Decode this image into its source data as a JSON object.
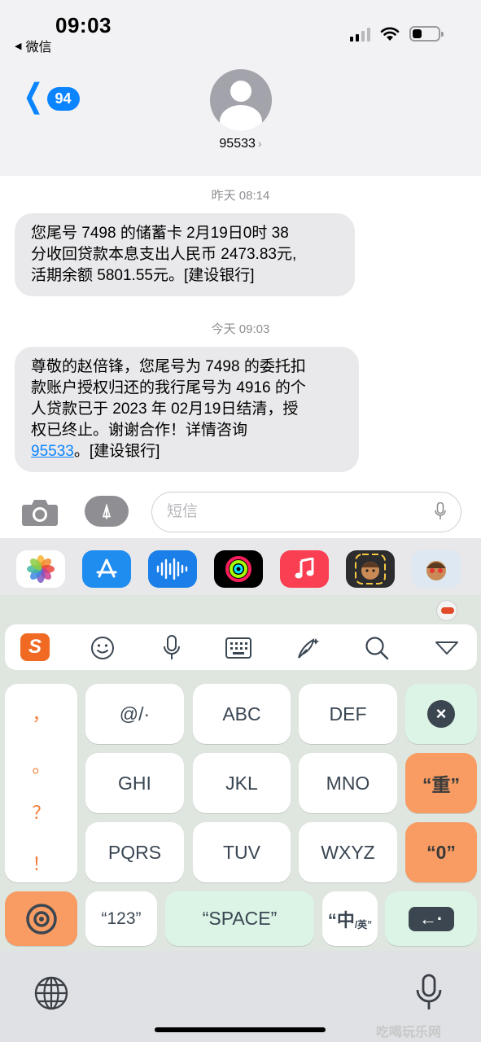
{
  "status_bar": {
    "time": "09:03",
    "back_app": "微信",
    "battery_level": 0.35
  },
  "header": {
    "back_badge": "94",
    "contact": "95533",
    "contact_chevron": "›"
  },
  "conversation": [
    {
      "timestamp": "昨天 08:14",
      "lines": [
        "您尾号 7498 的储蓄卡 2月19日0时 38",
        "分收回贷款本息支出人民币 2473.83元,",
        "活期余额 5801.55元。[建设银行]"
      ]
    },
    {
      "timestamp": "今天 09:03",
      "lines": [
        "尊敬的赵倍锋，您尾号为 7498 的委托扣",
        "款账户授权归还的我行尾号为 4916 的个",
        "人贷款已于 2023 年 02月19日结清，授",
        "权已终止。谢谢合作！详情咨询"
      ],
      "link": "95533",
      "tail": "。[建设银行]"
    }
  ],
  "input": {
    "placeholder": "短信"
  },
  "app_strip": {
    "icons": [
      "photos-icon",
      "app-store-icon",
      "audio-message-icon",
      "activity-icon",
      "music-icon",
      "memoji-icon",
      "memoji-hearts-icon"
    ]
  },
  "keyboard": {
    "toolbar_icons": [
      "sogou-logo-icon",
      "emoji-icon",
      "voice-icon",
      "keyboard-icon",
      "quill-icon",
      "search-icon",
      "collapse-icon"
    ],
    "sogou_letter": "S",
    "punctuation": [
      "，",
      "。",
      "？",
      "！"
    ],
    "keys_row1": [
      "@/·",
      "ABC",
      "DEF"
    ],
    "keys_row2": [
      "GHI",
      "JKL",
      "MNO"
    ],
    "keys_row3": [
      "PQRS",
      "TUV",
      "WXYZ"
    ],
    "delete": "×",
    "reenter": "“重”",
    "zero": "“0”",
    "num_key": "“123”",
    "space": "“SPACE”",
    "lang_main": "“中",
    "lang_sub": "/英”",
    "enter": "←·"
  },
  "watermark": "吃喝玩乐网"
}
